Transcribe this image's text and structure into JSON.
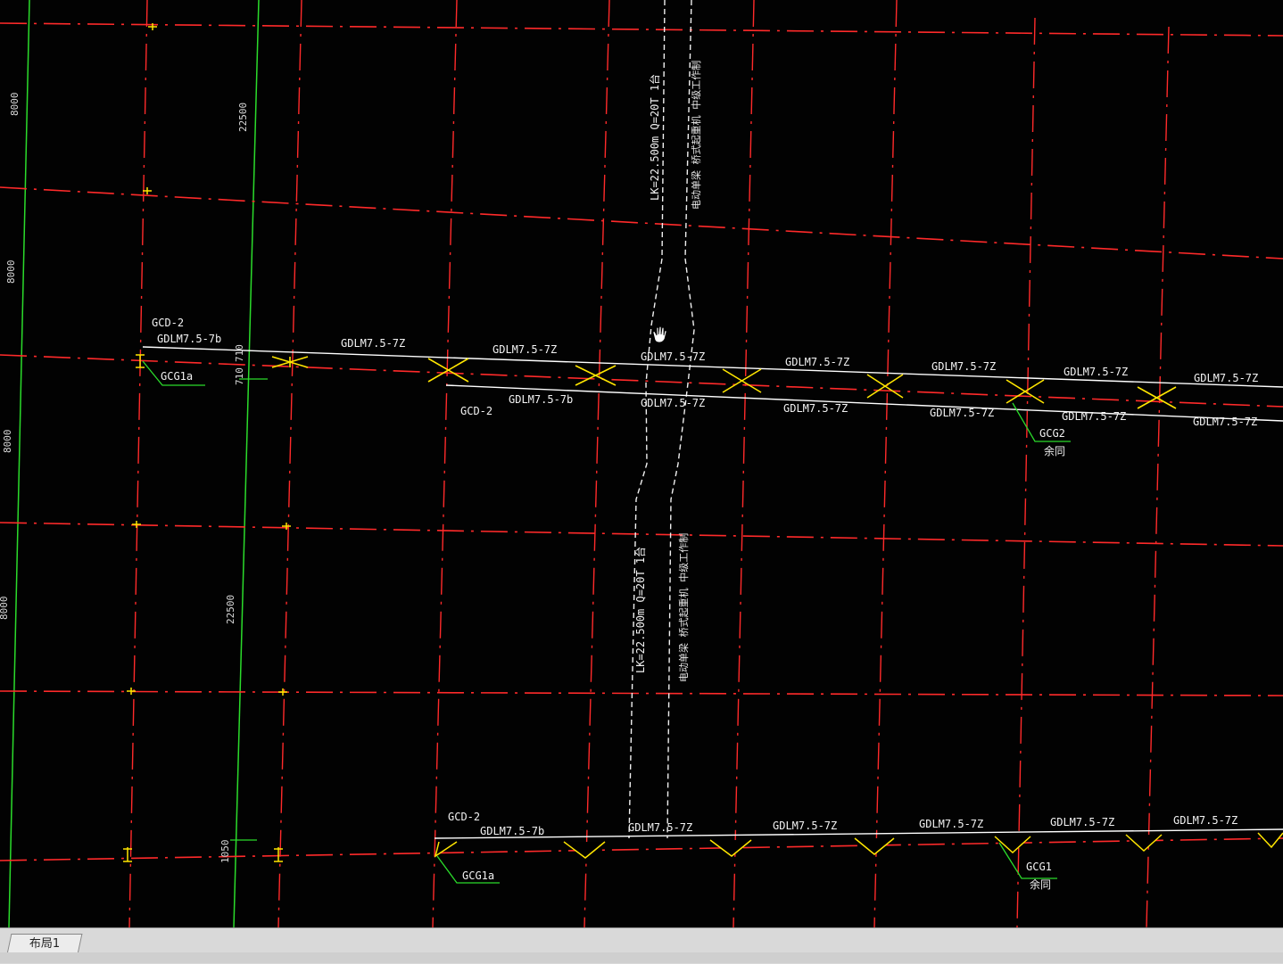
{
  "drawing": {
    "beam_top_1": [
      "GDLM7.5-7Z",
      "GDLM7.5-7Z",
      "GDLM7.5-7Z",
      "GDLM7.5-7Z",
      "GDLM7.5-7Z",
      "GDLM7.5-7Z",
      "GDLM7.5-7Z"
    ],
    "beam_top_1_first": "GDLM7.5-7b",
    "beam_bottom_1_first": "GDLM7.5-7b",
    "beam_bottom_1": [
      "GDLM7.5-7Z",
      "GDLM7.5-7Z",
      "GDLM7.5-7Z",
      "GDLM7.5-7Z",
      "GDLM7.5-7Z"
    ],
    "beam_2_first": "GDLM7.5-7b",
    "beam_2": [
      "GDLM7.5-7Z",
      "GDLM7.5-7Z",
      "GDLM7.5-7Z",
      "GDLM7.5-7Z",
      "GDLM7.5-7Z"
    ],
    "gcd_labels": [
      "GCD-2",
      "GCD-2",
      "GCD-2"
    ],
    "gcg1a": "GCG1a",
    "gcg2": "GCG2",
    "gcg1": "GCG1",
    "same_note": "余同",
    "crane_label": "LK=22.500m Q=20T 1台",
    "crane_note": "电动单梁 桥式起重机 中级工作制",
    "dims_left": [
      "8000",
      "8000",
      "8000",
      "8000"
    ],
    "dims_mid": [
      "22500",
      "22500"
    ],
    "dim_710a": "710",
    "dim_710b": "710",
    "dim_1050": "1050"
  },
  "tabs": {
    "layout1": "布局1"
  },
  "colors": {
    "axis": "#ff2a2a",
    "beam": "#ffffff",
    "bracing": "#ffe600",
    "leader": "#22dd22",
    "crane": "#ffffff",
    "background": "#020202"
  }
}
